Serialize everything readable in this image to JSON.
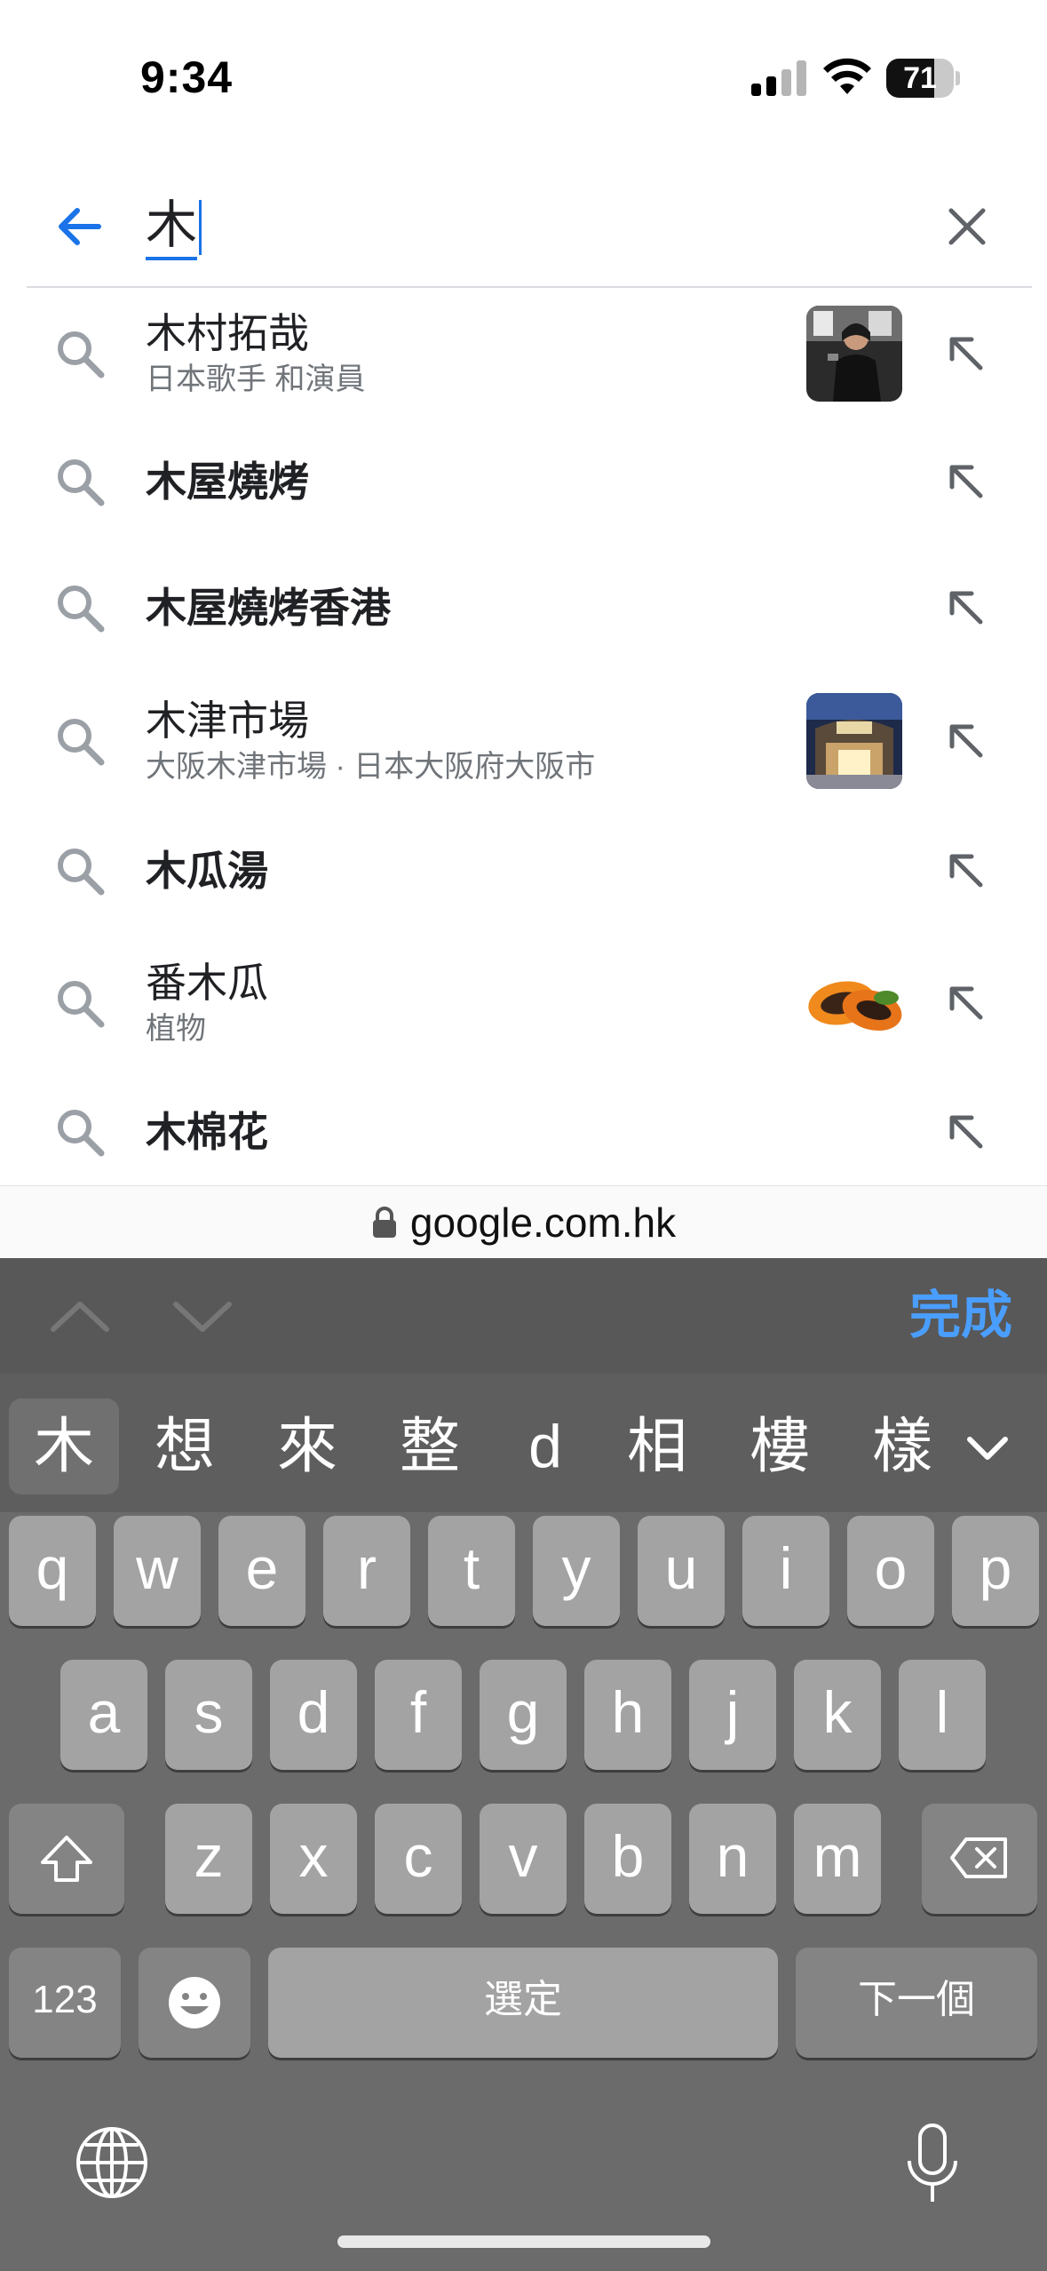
{
  "status_bar": {
    "time": "9:34",
    "battery": "71",
    "battery_level": 0.71
  },
  "search": {
    "query": "木",
    "back_icon": "arrow-left-icon",
    "clear_icon": "close-icon",
    "accent_color": "#1a73e8"
  },
  "suggestions": [
    {
      "title": "木村拓哉",
      "subtitle": "日本歌手 和演員",
      "bold": false,
      "thumbnail": "person-photo"
    },
    {
      "title": "木屋燒烤",
      "subtitle": "",
      "bold": true,
      "thumbnail": ""
    },
    {
      "title": "木屋燒烤香港",
      "subtitle": "",
      "bold": true,
      "thumbnail": ""
    },
    {
      "title": "木津市場",
      "subtitle": "大阪木津市場 · 日本大阪府大阪市",
      "bold": false,
      "thumbnail": "market-photo"
    },
    {
      "title": "木瓜湯",
      "subtitle": "",
      "bold": true,
      "thumbnail": ""
    },
    {
      "title": "番木瓜",
      "subtitle": "植物",
      "bold": false,
      "thumbnail": "papaya-photo"
    },
    {
      "title": "木棉花",
      "subtitle": "",
      "bold": true,
      "thumbnail": ""
    }
  ],
  "url_bar": {
    "url": "google.com.hk",
    "lock_icon": "lock-icon"
  },
  "keyboard": {
    "done_label": "完成",
    "done_color": "#4a9eff",
    "candidates": [
      "木",
      "想",
      "來",
      "整",
      "d",
      "相",
      "樓",
      "樣"
    ],
    "row1": [
      "q",
      "w",
      "e",
      "r",
      "t",
      "y",
      "u",
      "i",
      "o",
      "p"
    ],
    "row2": [
      "a",
      "s",
      "d",
      "f",
      "g",
      "h",
      "j",
      "k",
      "l"
    ],
    "row3": [
      "z",
      "x",
      "c",
      "v",
      "b",
      "n",
      "m"
    ],
    "numbers_label": "123",
    "space_label": "選定",
    "next_label": "下一個"
  }
}
